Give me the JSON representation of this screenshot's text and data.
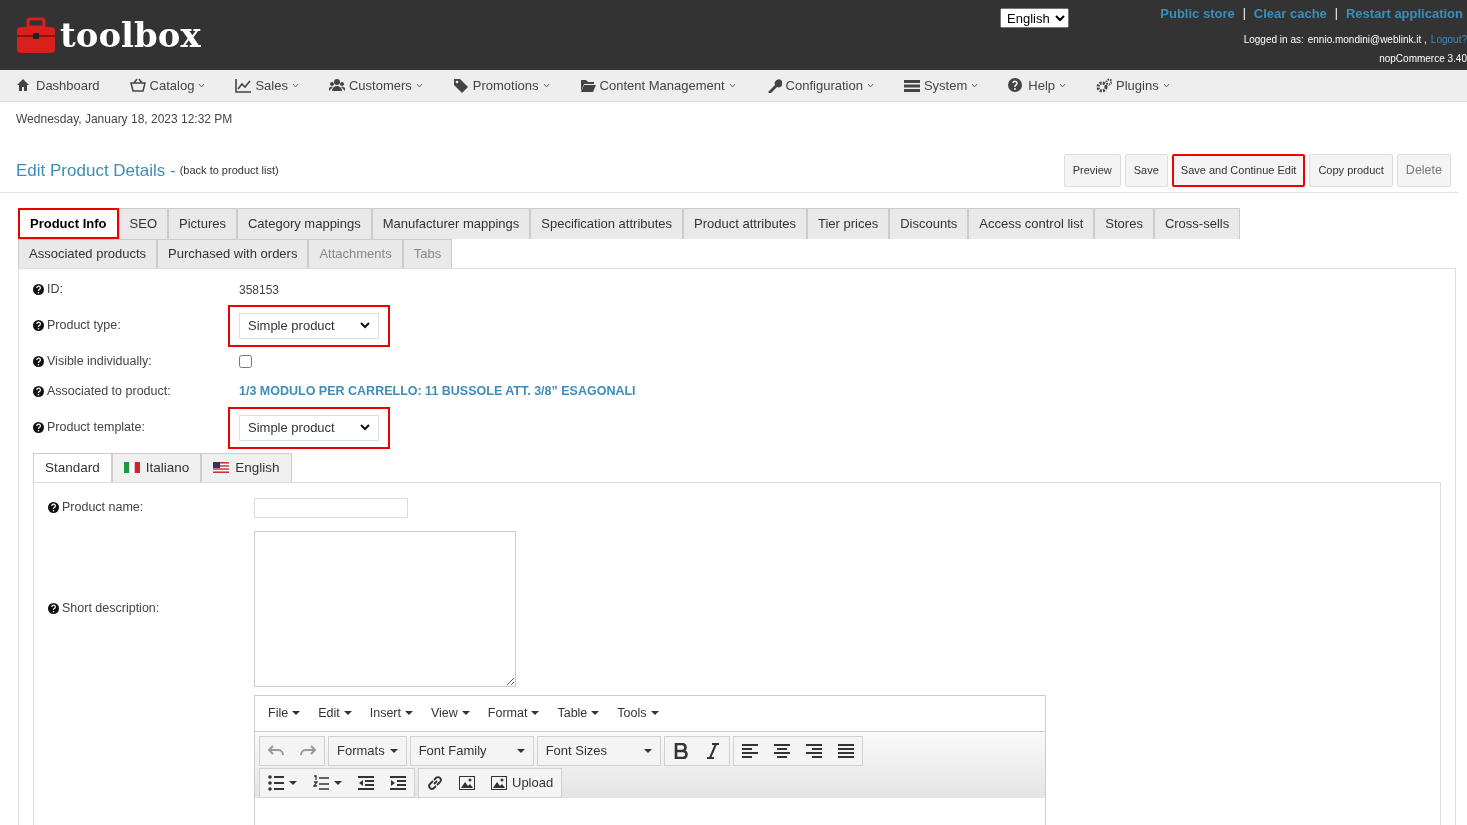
{
  "header": {
    "logo_text": "toolbox",
    "language": "English",
    "links": [
      "Public store",
      "Clear cache",
      "Restart application"
    ],
    "separator": "|",
    "logged_in_label": "Logged in as:",
    "user": "ennio.mondini@weblink.it ,",
    "logout": "Logout?",
    "version": "nopCommerce 3.40"
  },
  "menu": [
    {
      "label": "Dashboard",
      "dropdown": false
    },
    {
      "label": "Catalog",
      "dropdown": true
    },
    {
      "label": "Sales",
      "dropdown": true
    },
    {
      "label": "Customers",
      "dropdown": true
    },
    {
      "label": "Promotions",
      "dropdown": true
    },
    {
      "label": "Content Management",
      "dropdown": true
    },
    {
      "label": "Configuration",
      "dropdown": true
    },
    {
      "label": "System",
      "dropdown": true
    },
    {
      "label": "Help",
      "dropdown": true
    },
    {
      "label": "Plugins",
      "dropdown": true
    }
  ],
  "date": "Wednesday, January 18, 2023 12:32 PM",
  "page": {
    "title": "Edit Product Details -",
    "back_link": "(back to product list)"
  },
  "buttons": [
    {
      "label": "Preview",
      "highlighted": false,
      "disabled": false
    },
    {
      "label": "Save",
      "highlighted": false,
      "disabled": false
    },
    {
      "label": "Save and Continue Edit",
      "highlighted": true,
      "disabled": false
    },
    {
      "label": "Copy product",
      "highlighted": false,
      "disabled": false
    },
    {
      "label": "Delete",
      "highlighted": false,
      "disabled": true
    }
  ],
  "tab_rows": [
    [
      {
        "label": "Product Info",
        "selected": true,
        "highlighted": true,
        "disabled": false
      },
      {
        "label": "SEO",
        "selected": false,
        "highlighted": false,
        "disabled": false
      },
      {
        "label": "Pictures",
        "selected": false,
        "highlighted": false,
        "disabled": false
      },
      {
        "label": "Category mappings",
        "selected": false,
        "highlighted": false,
        "disabled": false
      },
      {
        "label": "Manufacturer mappings",
        "selected": false,
        "highlighted": false,
        "disabled": false
      },
      {
        "label": "Specification attributes",
        "selected": false,
        "highlighted": false,
        "disabled": false
      },
      {
        "label": "Product attributes",
        "selected": false,
        "highlighted": false,
        "disabled": false
      },
      {
        "label": "Tier prices",
        "selected": false,
        "highlighted": false,
        "disabled": false
      },
      {
        "label": "Discounts",
        "selected": false,
        "highlighted": false,
        "disabled": false
      },
      {
        "label": "Access control list",
        "selected": false,
        "highlighted": false,
        "disabled": false
      },
      {
        "label": "Stores",
        "selected": false,
        "highlighted": false,
        "disabled": false
      },
      {
        "label": "Cross-sells",
        "selected": false,
        "highlighted": false,
        "disabled": false
      }
    ],
    [
      {
        "label": "Associated products",
        "selected": false,
        "highlighted": false,
        "disabled": false
      },
      {
        "label": "Purchased with orders",
        "selected": false,
        "highlighted": false,
        "disabled": false
      },
      {
        "label": "Attachments",
        "selected": false,
        "highlighted": false,
        "disabled": true
      },
      {
        "label": "Tabs",
        "selected": false,
        "highlighted": false,
        "disabled": true
      }
    ]
  ],
  "fields": [
    {
      "kind": "text",
      "label": "ID:",
      "value": "358153"
    },
    {
      "kind": "select",
      "label": "Product type:",
      "value": "Simple product",
      "highlighted": true
    },
    {
      "kind": "checkbox",
      "label": "Visible individually:",
      "checked": false
    },
    {
      "kind": "link",
      "label": "Associated to product:",
      "value": "1/3 MODULO PER CARRELLO: 11 BUSSOLE ATT. 3/8” ESAGONALI"
    },
    {
      "kind": "select",
      "label": "Product template:",
      "value": "Simple product",
      "highlighted": true
    }
  ],
  "language_tabs": [
    {
      "label": "Standard",
      "selected": true
    },
    {
      "label": "Italiano",
      "selected": false
    },
    {
      "label": "English",
      "selected": false
    }
  ],
  "localized_fields": [
    {
      "kind": "input",
      "label": "Product name:"
    },
    {
      "kind": "textarea",
      "label": "Short description:"
    }
  ],
  "editor": {
    "menus": [
      "File",
      "Edit",
      "Insert",
      "View",
      "Format",
      "Table",
      "Tools"
    ],
    "toolbar_rows": [
      [
        {
          "kind": "icon"
        },
        {
          "kind": "icon"
        },
        {
          "kind": "sep"
        },
        {
          "kind": "dropdown",
          "label": "Formats"
        },
        {
          "kind": "sep"
        },
        {
          "kind": "wide",
          "label": "Font Family"
        },
        {
          "kind": "sep"
        },
        {
          "kind": "wide",
          "label": "Font Sizes"
        },
        {
          "kind": "sep"
        },
        {
          "kind": "icon"
        },
        {
          "kind": "icon"
        },
        {
          "kind": "sep"
        },
        {
          "kind": "icon"
        },
        {
          "kind": "icon"
        },
        {
          "kind": "icon"
        },
        {
          "kind": "icon"
        }
      ],
      [
        {
          "kind": "split"
        },
        {
          "kind": "split"
        },
        {
          "kind": "icon"
        },
        {
          "kind": "icon"
        },
        {
          "kind": "sep"
        },
        {
          "kind": "icon"
        },
        {
          "kind": "icon"
        },
        {
          "kind": "labeled",
          "label": "Upload"
        }
      ]
    ]
  }
}
